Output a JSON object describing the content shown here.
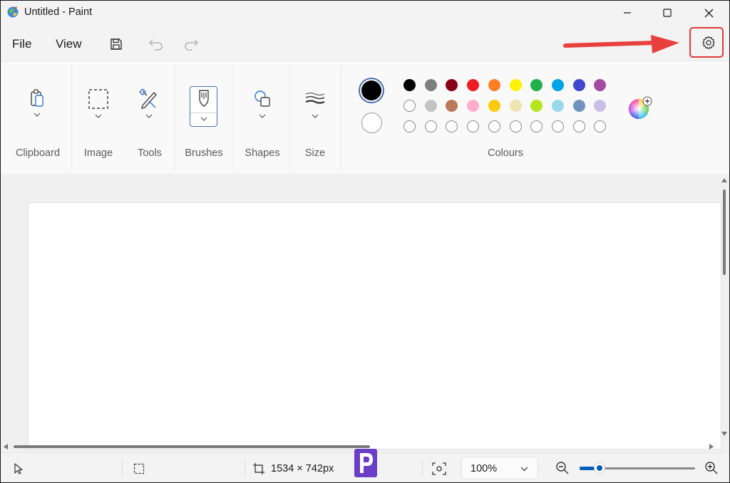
{
  "window": {
    "title": "Untitled - Paint"
  },
  "menu": {
    "file": "File",
    "view": "View"
  },
  "ribbon": {
    "groups": {
      "clipboard": "Clipboard",
      "image": "Image",
      "tools": "Tools",
      "brushes": "Brushes",
      "shapes": "Shapes",
      "size": "Size",
      "colours": "Colours"
    },
    "primary_colour": "#000000",
    "secondary_colour": "#ffffff",
    "palette_row1": [
      "#000000",
      "#7f7f7f",
      "#880015",
      "#ed1c24",
      "#ff7f27",
      "#fff200",
      "#22b14c",
      "#00a2e8",
      "#3f48cc",
      "#a349a4"
    ],
    "palette_row2": [
      "#ffffff",
      "#c3c3c3",
      "#b97a57",
      "#ffaec9",
      "#ffc90e",
      "#efe4b0",
      "#b5e61d",
      "#99d9ea",
      "#7092be",
      "#c8bfe7"
    ]
  },
  "status": {
    "canvas_size": "1534 × 742px",
    "zoom_value": "100%",
    "zoom_slider_level": 0.14
  },
  "icons": [
    "app-icon",
    "save-icon",
    "undo-icon",
    "redo-icon",
    "settings-icon",
    "clipboard-icon",
    "select-icon",
    "tools-icon",
    "brush-icon",
    "shapes-icon",
    "size-icon",
    "colour-picker-icon",
    "pointer-icon",
    "selection-icon",
    "canvas-size-icon",
    "fit-icon",
    "zoom-out-icon",
    "zoom-in-icon",
    "watermark-logo"
  ],
  "accent": {
    "highlight": "#e03a3a",
    "arrow": "#e8413d",
    "selected": "#4a6fb0"
  }
}
